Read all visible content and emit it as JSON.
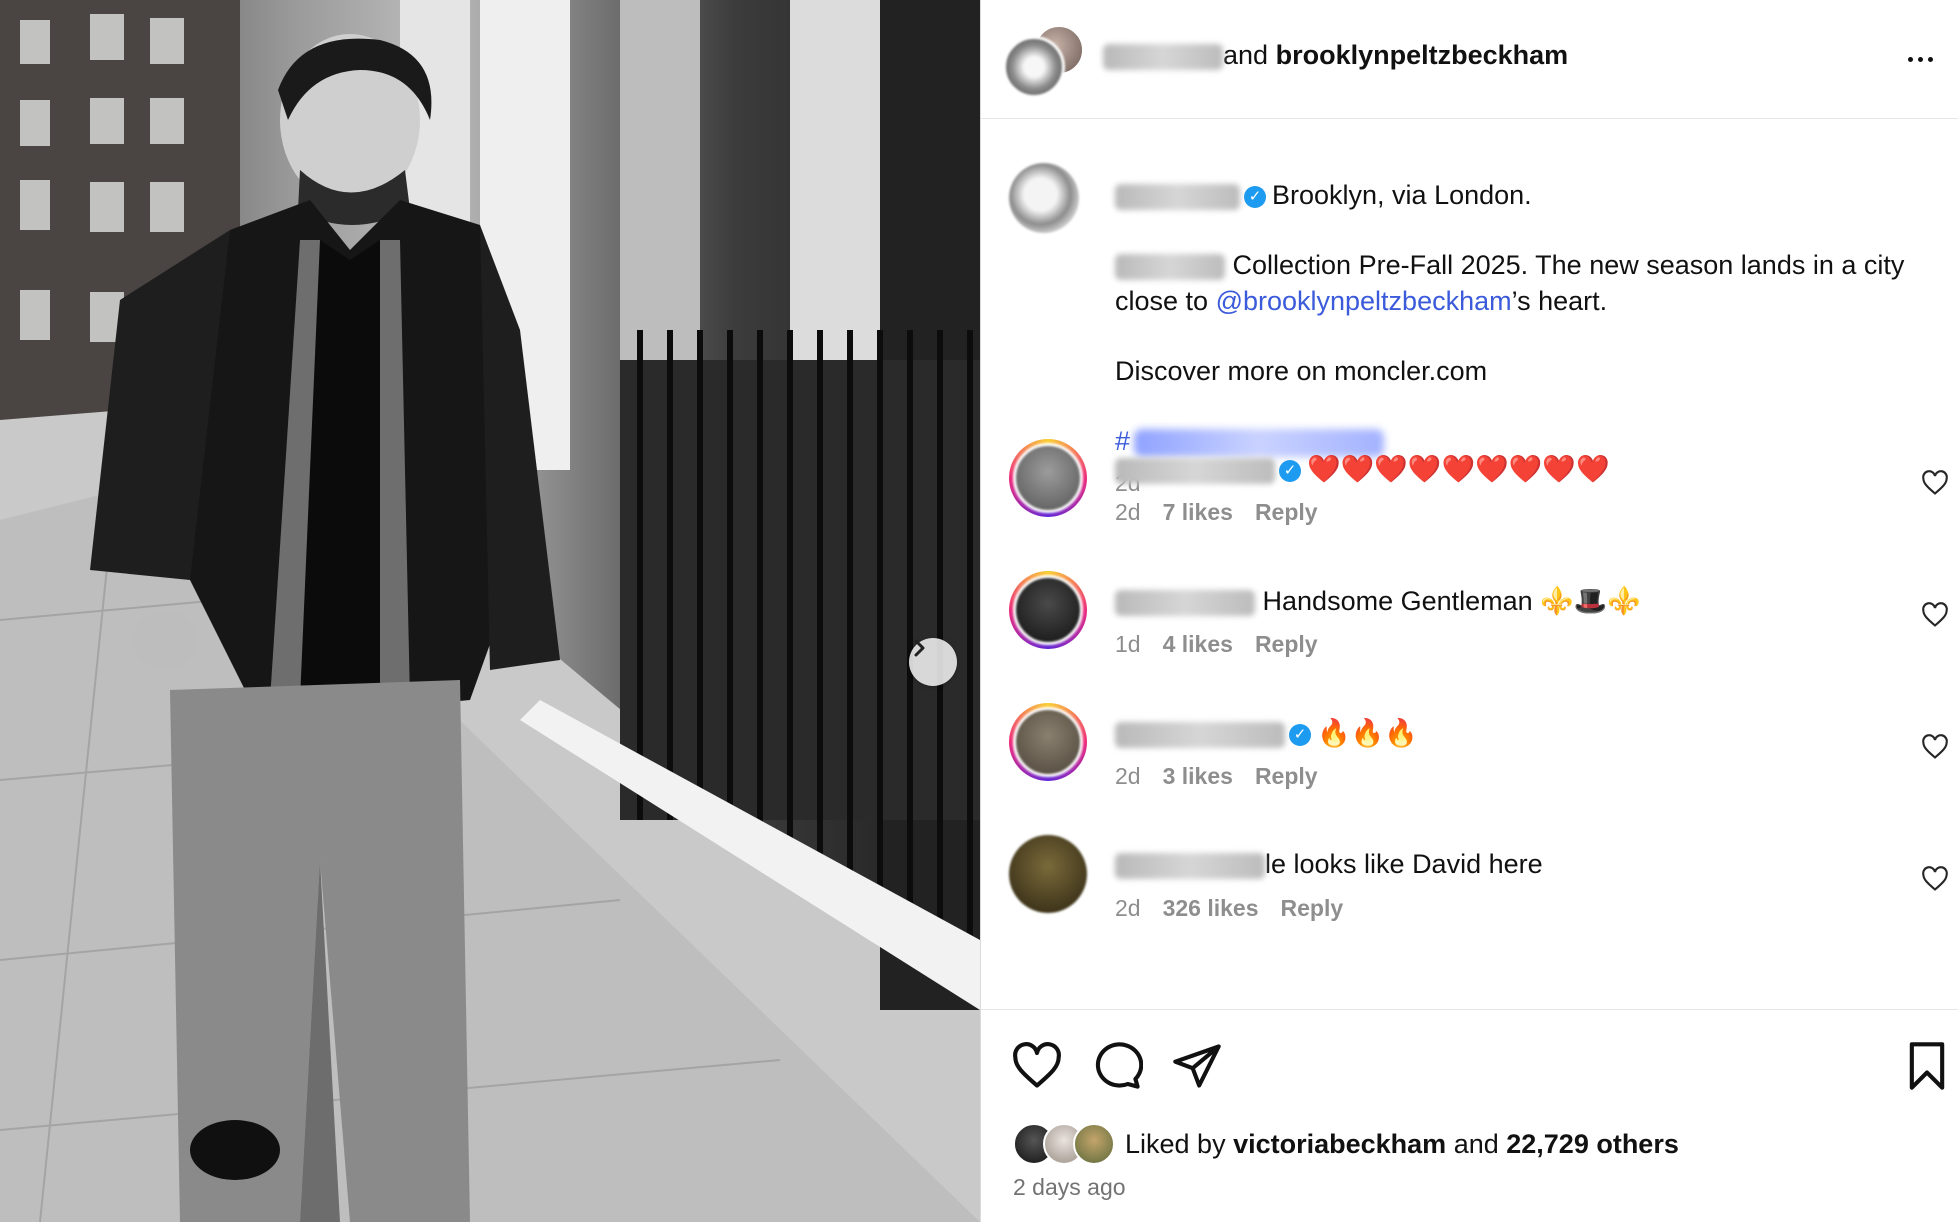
{
  "header": {
    "connector": "and",
    "collab_username": "brooklynpeltzbeckham",
    "more_label": "More options"
  },
  "caption": {
    "headline": "Brooklyn, via London.",
    "line1": "Collection Pre-Fall 2025. The new season lands in a city",
    "line2_prefix": "close to ",
    "mention": "@brooklynpeltzbeckham",
    "line2_suffix": "’s heart.",
    "discover": "Discover more on moncler.com",
    "hashtag_prefix": "#",
    "time": "2d"
  },
  "comments": [
    {
      "text": "❤️❤️❤️❤️❤️❤️❤️❤️❤️",
      "time": "2d",
      "likes": "7 likes",
      "reply": "Reply",
      "verified": true
    },
    {
      "text": "Handsome Gentleman ⚜️🎩⚜️",
      "time": "1d",
      "likes": "4 likes",
      "reply": "Reply",
      "verified": false
    },
    {
      "text": "🔥🔥🔥",
      "time": "2d",
      "likes": "3 likes",
      "reply": "Reply",
      "verified": true
    },
    {
      "text": "le looks like David here",
      "time": "2d",
      "likes": "326 likes",
      "reply": "Reply",
      "verified": false
    }
  ],
  "footer": {
    "liked_by_prefix": "Liked by ",
    "liked_by_user": "victoriabeckham",
    "liked_by_and": " and ",
    "liked_by_count": "22,729 others",
    "posted_ago": "2 days ago"
  },
  "colors": {
    "link": "#3b5bdb",
    "heart_red": "#ed4956",
    "muted": "#8e8e8e",
    "verified": "#1d9bf0"
  },
  "icons": [
    "chevron-right-icon",
    "more-icon",
    "verified-icon",
    "heart-icon",
    "comment-icon",
    "share-icon",
    "bookmark-icon"
  ]
}
